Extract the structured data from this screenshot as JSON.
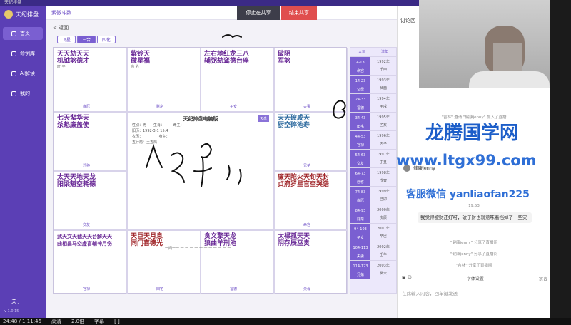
{
  "app": {
    "title": "天纪排盘",
    "topbar_title": "紫微斗数",
    "back_label": "< 返回"
  },
  "sidebar": {
    "items": [
      {
        "label": "首页"
      },
      {
        "label": "命例库"
      },
      {
        "label": "AI解读"
      },
      {
        "label": "我的"
      }
    ],
    "about": "关于",
    "version": "v 1.0.15"
  },
  "share": {
    "stop_label": "停止在共享",
    "end_label": "结束共享"
  },
  "tabs": [
    {
      "label": "飞星"
    },
    {
      "label": "三合"
    },
    {
      "label": "四化"
    }
  ],
  "chart": {
    "cells": [
      {
        "stars": "天天劫天天",
        "stars_b": "机钺煞德才",
        "sub": "旺 平",
        "palace": "疾厄"
      },
      {
        "stars": "紫铃天",
        "stars_b": "微星福",
        "sub": "庙 陷",
        "palace": "财帛"
      },
      {
        "stars": "左右地红龙三八",
        "stars_b": "辅弼劫鸾德台座",
        "sub": "",
        "palace": "子女"
      },
      {
        "stars": "破阴",
        "stars_b": "军煞",
        "sub": "",
        "palace": "夫妻"
      },
      {
        "stars": "七天蜚华天",
        "stars_b": "杀魁廉盖使",
        "sub": "",
        "palace": "迁移"
      },
      {
        "stars": "天天破咸天",
        "stars_b": "厨空碎池寿",
        "sub": "",
        "palace": "兄弟"
      },
      {
        "stars": "太天天地天龙",
        "stars_b": "阳梁魁空耗德",
        "sub": "",
        "palace": "交友"
      },
      {
        "stars": "廉天陀火天旬天封",
        "stars_b": "贞府罗星官空哭诰",
        "sub": "",
        "palace": "命宫"
      },
      {
        "stars": "武天文天截天天台解天天",
        "stars_b": "曲相昌马空虚喜辅神月伤",
        "sub": "",
        "palace": "官禄"
      },
      {
        "stars": "天巨天月息",
        "stars_b": "同门喜德光",
        "sub": "",
        "palace": "田宅"
      },
      {
        "stars": "贪文擎天龙",
        "stars_b": "狼曲羊刑池",
        "sub": "",
        "palace": "福德"
      },
      {
        "stars": "太禄孤天天",
        "stars_b": "阴存辰巫贵",
        "sub": "",
        "palace": "父母"
      }
    ],
    "center": {
      "title": "天纪排盘电脑版",
      "badge": "天盘",
      "lines": [
        "性别：男　　生肖：　　　命主：",
        "阳历：1992-3-1 15:4",
        "农历：　　　　　身主：",
        "五行局：土五局"
      ]
    },
    "bottom_strip": "一间一一 一 一 一 一 一 一 一 一 一 一 一"
  },
  "side_list": {
    "head": [
      "大运",
      "流年"
    ],
    "rows": [
      {
        "a": "4-13\n命宫",
        "b": "1992年\n壬申"
      },
      {
        "a": "14-23\n父母",
        "b": "1993年\n癸酉"
      },
      {
        "a": "24-33\n福德",
        "b": "1994年\n甲戌"
      },
      {
        "a": "34-43\n田宅",
        "b": "1995年\n乙亥"
      },
      {
        "a": "44-53\n官禄",
        "b": "1996年\n丙子"
      },
      {
        "a": "54-63\n交友",
        "b": "1997年\n丁丑"
      },
      {
        "a": "64-73\n迁移",
        "b": "1998年\n戊寅"
      },
      {
        "a": "74-83\n疾厄",
        "b": "1999年\n己卯"
      },
      {
        "a": "84-93\n财帛",
        "b": "2000年\n庚辰"
      },
      {
        "a": "94-103\n子女",
        "b": "2001年\n辛巳"
      },
      {
        "a": "104-113\n夫妻",
        "b": "2002年\n壬午"
      },
      {
        "a": "114-123\n兄弟",
        "b": "2003年\n癸未"
      }
    ]
  },
  "chat": {
    "title": "讨论区",
    "sys1": "\"吉林\" 邀请 \"健康jenny\" 加入了直播",
    "user": "健康jenny",
    "time": "19:53",
    "bubble": "我觉得被财还好呀，破了财也就意味着挡掉了一些灾",
    "sys2": "\"健康jenny\" 分享了直播间",
    "sys3": "\"健康jenny\" 分享了直播间",
    "sys4": "\"吉林\" 分享了直播间",
    "tools": {
      "font": "字体设置",
      "mute": "禁言"
    },
    "input_placeholder": "在此输入内容，回车键发送"
  },
  "watermark": {
    "line1": "龙腾国学网",
    "line2": "www.ltgx99.com",
    "line3": "客服微信 yanliaofan225"
  },
  "bottom_bar": "24:48 / 1:11:46　　高清　　2.0倍　　字幕　　[ ]"
}
